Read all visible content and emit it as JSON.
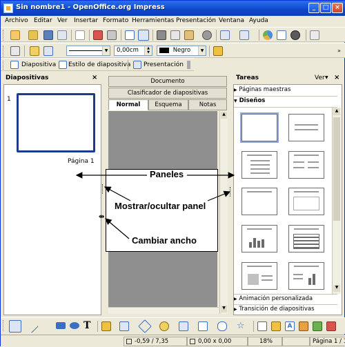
{
  "window": {
    "title": "Sin nombre1 - OpenOffice.org Impress",
    "controls": {
      "minimize": "_",
      "maximize": "□",
      "close": "×"
    }
  },
  "menubar": [
    "Archivo",
    "Editar",
    "Ver",
    "Insertar",
    "Formato",
    "Herramientas",
    "Presentación",
    "Ventana",
    "Ayuda"
  ],
  "line_toolbar": {
    "line_width": "0,00cm",
    "color": "Negro",
    "color_hex": "#000000"
  },
  "presentation_toolbar": {
    "slide_button": "Diapositiva",
    "slide_style_button": "Estilo de diapositiva",
    "presentation_button": "Presentación"
  },
  "slides_pane": {
    "title": "Diapositivas",
    "close": "×",
    "slide_number": "1",
    "slide_caption": "Página 1"
  },
  "view_tabs": {
    "top": [
      "Documento",
      "Clasificador de diapositivas"
    ],
    "bottom": [
      "Normal",
      "Esquema",
      "Notas"
    ],
    "active": "Normal"
  },
  "tasks_pane": {
    "title": "Tareas",
    "view_menu": "Ver",
    "close": "×",
    "sections": [
      {
        "label": "Páginas maestras",
        "expanded": false
      },
      {
        "label": "Diseños",
        "expanded": true
      },
      {
        "label": "Animación personalizada",
        "expanded": false
      },
      {
        "label": "Transición de diapositivas",
        "expanded": false
      }
    ],
    "layouts": [
      "blank",
      "title-only",
      "title-bullets",
      "title-two-columns",
      "title-line",
      "title-content",
      "title-chart",
      "title-table",
      "title-picture",
      "title-chart-side"
    ]
  },
  "callouts": {
    "panels": "Paneles",
    "toggle": "Mostrar/ocultar panel",
    "resize": "Cambiar ancho"
  },
  "statusbar": {
    "position": "-0,59 / 7,35",
    "size": "0,00 x 0,00",
    "zoom": "18%",
    "page": "Página 1 / 1"
  },
  "colors": {
    "titlebar": "#0d47c9",
    "selection_border": "#1c3b8c",
    "edit_area": "#8f8f8f"
  }
}
